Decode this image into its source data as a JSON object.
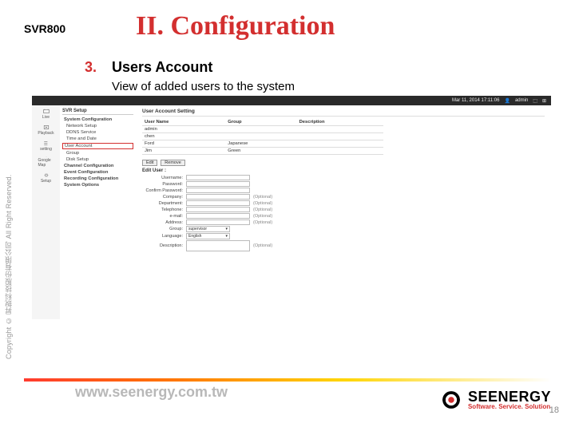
{
  "model": "SVR800",
  "title": "II.   Configuration",
  "section": {
    "num": "3.",
    "title": "Users Account"
  },
  "desc": "View of added users to the system",
  "copyright": "Copyright © 昇銳科技股份有限公司  All Right Reserved.",
  "shot": {
    "header": {
      "date": "Mar 11, 2014 17:11:06",
      "user": "admin"
    },
    "nav": [
      "Live",
      "Playback",
      "setting",
      "Google Map",
      "Setup"
    ],
    "tree": {
      "title": "SVR Setup",
      "items": [
        {
          "label": "System Configuration",
          "bold": true
        },
        {
          "label": "Network Setup"
        },
        {
          "label": "DDNS Service"
        },
        {
          "label": "Time and Date"
        },
        {
          "label": "User Account",
          "boxed": true
        },
        {
          "label": "Group"
        },
        {
          "label": "Disk Setup"
        },
        {
          "label": "Channel Configuration",
          "bold": true
        },
        {
          "label": "Event Configuration",
          "bold": true
        },
        {
          "label": "Recording Configuration",
          "bold": true
        },
        {
          "label": "System Options",
          "bold": true
        }
      ]
    },
    "content": {
      "title": "User Account Setting",
      "tableHeaders": [
        "User Name",
        "Group",
        "Description"
      ],
      "rows": [
        {
          "user": "admin",
          "group": "",
          "desc": ""
        },
        {
          "user": "chen",
          "group": "",
          "desc": ""
        },
        {
          "user": "Ford",
          "group": "Japanese",
          "desc": ""
        },
        {
          "user": "Jim",
          "group": "Green",
          "desc": ""
        }
      ],
      "buttons": [
        "Edit",
        "Remove"
      ],
      "formTitle": "Edit User :",
      "fields": [
        {
          "label": "Username:",
          "hint": ""
        },
        {
          "label": "Password:",
          "hint": ""
        },
        {
          "label": "Confirm Password:",
          "hint": ""
        },
        {
          "label": "Company:",
          "hint": "(Optional)"
        },
        {
          "label": "Department:",
          "hint": "(Optional)"
        },
        {
          "label": "Telephone:",
          "hint": "(Optional)"
        },
        {
          "label": "e-mail:",
          "hint": "(Optional)"
        },
        {
          "label": "Address:",
          "hint": "(Optional)"
        }
      ],
      "groupLabel": "Group:",
      "groupValue": "supervisor",
      "langLabel": "Language:",
      "langValue": "English",
      "descLabel": "Description:",
      "descHint": "(Optional)"
    }
  },
  "footer": {
    "url": "www.seenergy.com.tw",
    "logoName": "SEENERGY",
    "logoTag": "Software. Service. Solution",
    "page": "18"
  }
}
